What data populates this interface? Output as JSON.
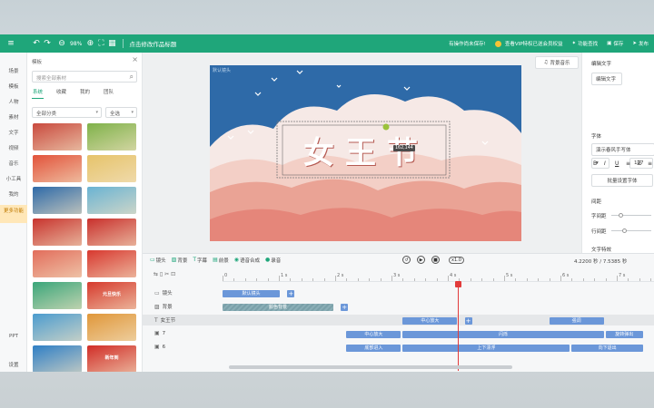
{
  "topbar": {
    "zoom": "98%",
    "title": "点击修改作品标题",
    "unsaved": "有操作尚未保存!",
    "vip": "查看VIP特权已送会员权益",
    "feature": "功能查找",
    "save": "保存",
    "publish": "发布"
  },
  "rail": [
    "场景",
    "模板",
    "人物",
    "素材",
    "文字",
    "视频",
    "音乐",
    "小工具",
    "我的",
    "更多功能",
    "PPT",
    "设置"
  ],
  "panel": {
    "header": "模板",
    "search_placeholder": "搜索全部素材",
    "tabs": [
      "系统",
      "收藏",
      "我的",
      "团队"
    ],
    "filter_category": "全部分类",
    "filter_scope": "全选",
    "thumbs": [
      {
        "label": "",
        "color": "#c94a3e"
      },
      {
        "label": "",
        "color": "#7fb24a"
      },
      {
        "label": "",
        "color": "#e2533b"
      },
      {
        "label": "",
        "color": "#e6c36a"
      },
      {
        "label": "",
        "color": "#2e6aa8"
      },
      {
        "label": "",
        "color": "#6ab3d3"
      },
      {
        "label": "",
        "color": "#c8342e"
      },
      {
        "label": "",
        "color": "#c9302c"
      },
      {
        "label": "",
        "color": "#e26d5b"
      },
      {
        "label": "",
        "color": "#d8382f"
      },
      {
        "label": "",
        "color": "#3aa67a"
      },
      {
        "label": "元旦快乐",
        "color": "#d63a2d"
      },
      {
        "label": "",
        "color": "#4c9ccf"
      },
      {
        "label": "",
        "color": "#e0973a"
      },
      {
        "label": "",
        "color": "#2f7fc5"
      },
      {
        "label": "新年到",
        "color": "#d12d27"
      }
    ]
  },
  "canvas": {
    "label": "默认镜头",
    "headline": "女王节",
    "coord": "162,144",
    "bgm": "背景音乐"
  },
  "props": {
    "header": "编辑文字",
    "edit_btn": "编辑文字",
    "font_label": "字体",
    "font_value": "演示春风手写体",
    "size": "127",
    "more_btn": "批量设置字体",
    "spacing_label": "间距",
    "char_spacing": "字间距",
    "line_spacing": "行间距",
    "effects_label": "文字特效",
    "shadow": "阴影"
  },
  "timeline": {
    "toolbar": [
      "镜头",
      "背景",
      "字幕",
      "前景",
      "语音合成",
      "录音"
    ],
    "speed": "x1.0",
    "time": "4.2200 秒 / 7.5385 秒",
    "ruler": [
      "0",
      "1 s",
      "2 s",
      "3 s",
      "4 s",
      "5 s",
      "6 s",
      "7 s"
    ],
    "tracks": [
      {
        "label": "镜头",
        "clips": [
          {
            "text": "默认镜头",
            "kind": "normal",
            "start": 0,
            "end": 1.05
          }
        ],
        "plus_at": 1.15
      },
      {
        "label": "背景",
        "clips": [
          {
            "text": "颜色背景",
            "kind": "bg",
            "start": 0,
            "end": 2.0
          }
        ],
        "plus_at": 2.1
      },
      {
        "label": "女王节",
        "clips": [
          {
            "text": "中心放大",
            "kind": "normal",
            "start": 3.2,
            "end": 4.2
          },
          {
            "text": "强调",
            "kind": "normal",
            "start": 5.8,
            "end": 6.8
          }
        ],
        "plus_at": 4.3,
        "highlight": true
      },
      {
        "label": "7",
        "clips": [
          {
            "text": "中心放大",
            "kind": "normal",
            "start": 2.2,
            "end": 3.2
          },
          {
            "text": "闪烁",
            "kind": "normal",
            "start": 3.2,
            "end": 6.8
          },
          {
            "text": "旋转弹出",
            "kind": "normal",
            "start": 6.8,
            "end": 7.5
          }
        ]
      },
      {
        "label": "6",
        "clips": [
          {
            "text": "底部进入",
            "kind": "normal",
            "start": 2.2,
            "end": 3.2
          },
          {
            "text": "上下漂浮",
            "kind": "normal",
            "start": 3.2,
            "end": 6.2
          },
          {
            "text": "向下退出",
            "kind": "normal",
            "start": 6.2,
            "end": 7.5
          }
        ]
      }
    ]
  }
}
